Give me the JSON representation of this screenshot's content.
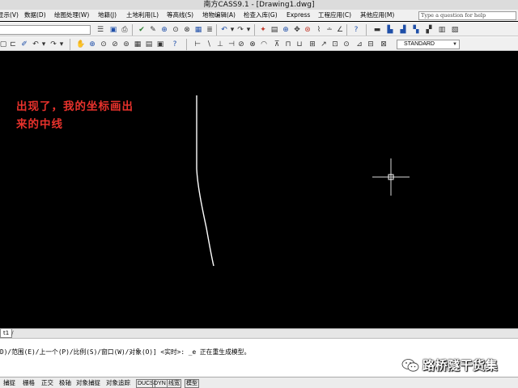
{
  "window": {
    "title": "南方CASS9.1 - [Drawing1.dwg]"
  },
  "menubar": {
    "items": [
      "显示(V)",
      "数据(D)",
      "绘图处理(W)",
      "地籍(J)",
      "土地利用(L)",
      "等高线(S)",
      "地物编辑(A)",
      "检查入库(G)",
      "Express",
      "工程应用(C)",
      "其他应用(M)"
    ],
    "help_placeholder": "Type a question for help"
  },
  "toolbar2": {
    "text_style": "STANDARD"
  },
  "canvas": {
    "background": "#000000",
    "annotation_line1": "出现了，我的坐标画出",
    "annotation_line2": "来的中线",
    "annotation_color": "#e8322c",
    "line_color": "#ffffff"
  },
  "layout_tabs": {
    "active_tab": "t1"
  },
  "command": {
    "line": "D)/范围(E)/上一个(P)/比例(S)/窗口(W)/对象(O)] <实时>: _e 正在重生成模型。"
  },
  "watermark": {
    "text": "路桥隧干货集"
  },
  "statusbar": {
    "items": [
      "捕捉",
      "栅格",
      "正交",
      "极轴",
      "对象捕捉",
      "对象追踪",
      "DUCS",
      "DYN",
      "线宽",
      "模型"
    ]
  }
}
